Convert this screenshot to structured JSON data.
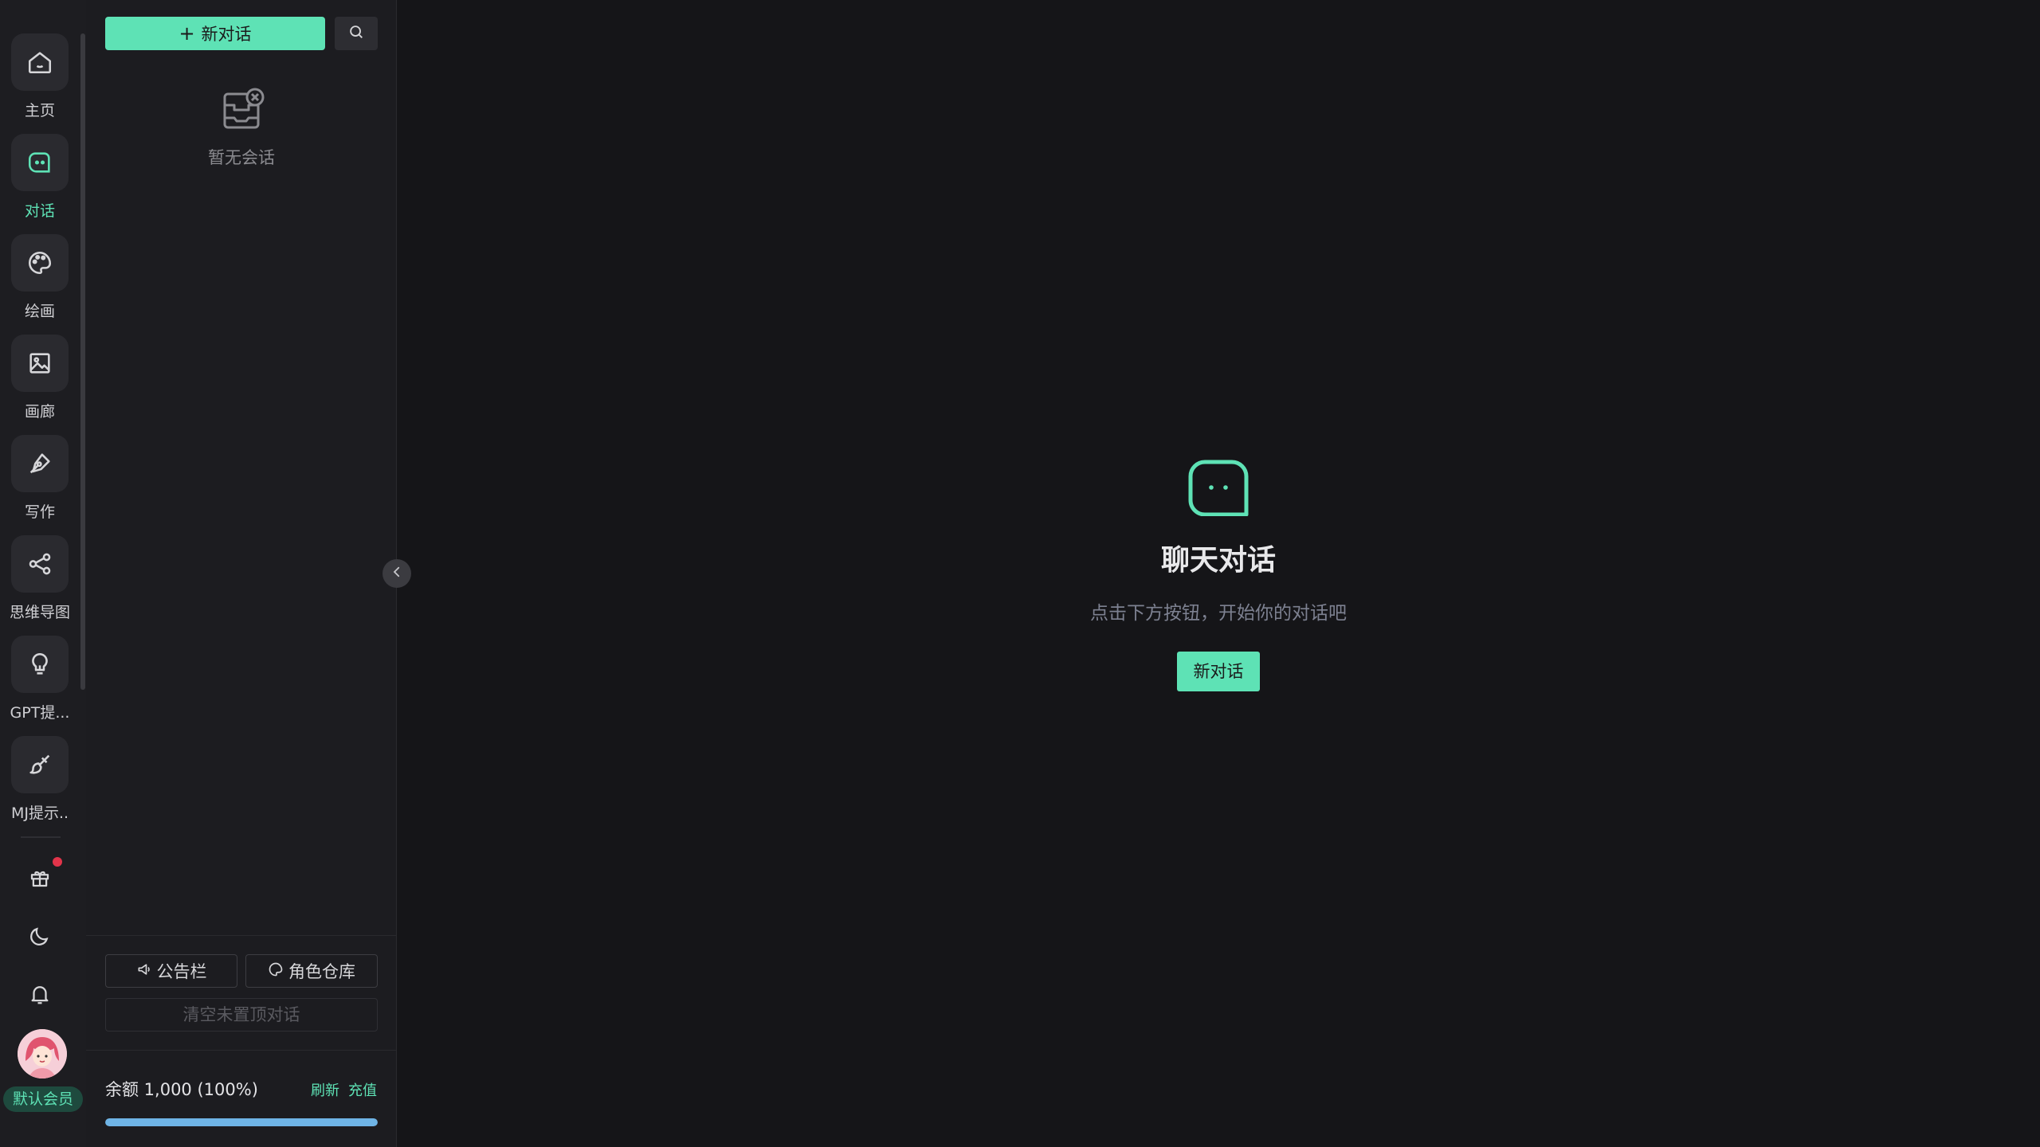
{
  "accent_color": "#5ee2b5",
  "nav": {
    "items": [
      {
        "label": "主页",
        "icon": "home-icon"
      },
      {
        "label": "对话",
        "icon": "chat-icon",
        "active": true
      },
      {
        "label": "绘画",
        "icon": "palette-icon"
      },
      {
        "label": "画廊",
        "icon": "image-icon"
      },
      {
        "label": "写作",
        "icon": "pen-icon"
      },
      {
        "label": "思维导图",
        "icon": "share-icon"
      },
      {
        "label": "GPT提...",
        "icon": "lightbulb-icon"
      },
      {
        "label": "MJ提示..",
        "icon": "brush-icon"
      }
    ],
    "utility_icons": [
      "gift-icon",
      "moon-icon",
      "bell-icon"
    ],
    "member_badge": "默认会员"
  },
  "panel": {
    "new_chat_label": "新对话",
    "empty_text": "暂无会话",
    "notice_label": "公告栏",
    "role_label": "角色仓库",
    "clear_label": "清空未置顶对话",
    "balance_text": "余额 1,000 (100%)",
    "balance_fraction": 1.0,
    "refresh_label": "刷新",
    "recharge_label": "充值"
  },
  "main": {
    "title": "聊天对话",
    "subtitle": "点击下方按钮，开始你的对话吧",
    "button_label": "新对话"
  }
}
